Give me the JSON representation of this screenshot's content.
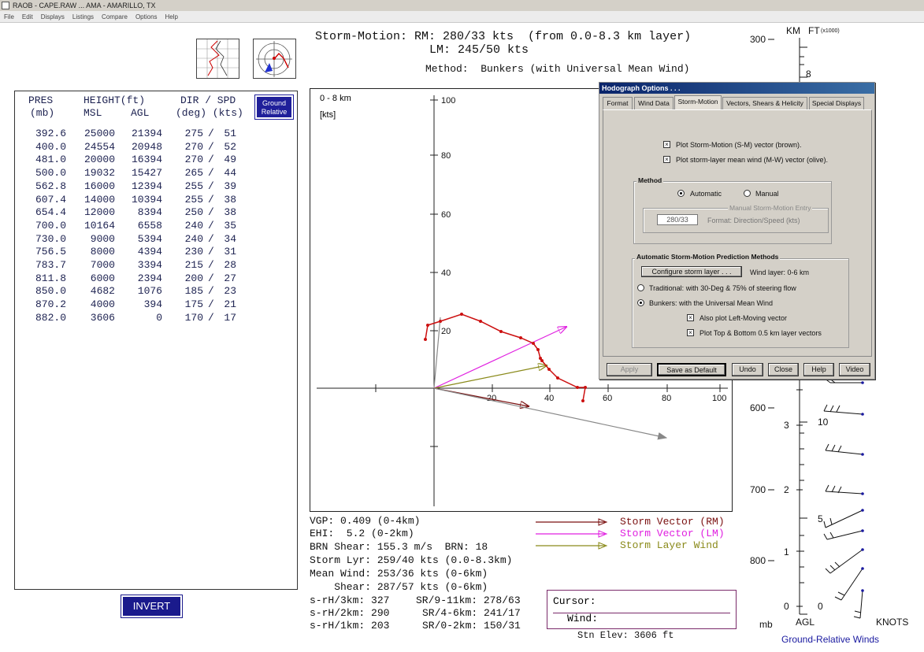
{
  "window": {
    "title": "RAOB  -  CAPE.RAW   ...   AMA - AMARILLO, TX"
  },
  "menu": [
    "File",
    "Edit",
    "Displays",
    "Listings",
    "Compare",
    "Options",
    "Help"
  ],
  "storm_motion": {
    "line1": "Storm-Motion: RM: 280/33 kts  (from 0.0-8.3 km layer)",
    "line2": "LM: 245/50 kts",
    "method": "Method:  Bunkers (with Universal Mean Wind)"
  },
  "table": {
    "headers": {
      "pres": "PRES",
      "pres_unit": "(mb)",
      "height": "HEIGHT(ft)",
      "msl": "MSL",
      "agl": "AGL",
      "dirspd": "DIR / SPD",
      "dirspd_unit": "(deg) (kts)"
    },
    "ground_relative_btn": "Ground Relative",
    "rows": [
      {
        "pres": "392.6",
        "msl": "25000",
        "agl": "21394",
        "dir": "275",
        "spd": "51"
      },
      {
        "pres": "400.0",
        "msl": "24554",
        "agl": "20948",
        "dir": "270",
        "spd": "52"
      },
      {
        "pres": "481.0",
        "msl": "20000",
        "agl": "16394",
        "dir": "270",
        "spd": "49"
      },
      {
        "pres": "500.0",
        "msl": "19032",
        "agl": "15427",
        "dir": "265",
        "spd": "44"
      },
      {
        "pres": "562.8",
        "msl": "16000",
        "agl": "12394",
        "dir": "255",
        "spd": "39"
      },
      {
        "pres": "607.4",
        "msl": "14000",
        "agl": "10394",
        "dir": "255",
        "spd": "38"
      },
      {
        "pres": "654.4",
        "msl": "12000",
        "agl": "8394",
        "dir": "250",
        "spd": "38"
      },
      {
        "pres": "700.0",
        "msl": "10164",
        "agl": "6558",
        "dir": "240",
        "spd": "35"
      },
      {
        "pres": "730.0",
        "msl": "9000",
        "agl": "5394",
        "dir": "240",
        "spd": "34"
      },
      {
        "pres": "756.5",
        "msl": "8000",
        "agl": "4394",
        "dir": "230",
        "spd": "31"
      },
      {
        "pres": "783.7",
        "msl": "7000",
        "agl": "3394",
        "dir": "215",
        "spd": "28"
      },
      {
        "pres": "811.8",
        "msl": "6000",
        "agl": "2394",
        "dir": "200",
        "spd": "27"
      },
      {
        "pres": "850.0",
        "msl": "4682",
        "agl": "1076",
        "dir": "185",
        "spd": "23"
      },
      {
        "pres": "870.2",
        "msl": "4000",
        "agl": "394",
        "dir": "175",
        "spd": "21"
      },
      {
        "pres": "882.0",
        "msl": "3606",
        "agl": "0",
        "dir": "170",
        "spd": "17"
      }
    ],
    "invert_btn": "INVERT"
  },
  "hodograph": {
    "layer_label": "0 - 8 km",
    "units_label": "[kts]",
    "y_ticks": [
      "100",
      "80",
      "60",
      "40",
      "20"
    ],
    "x_ticks": [
      "20",
      "40",
      "60",
      "80",
      "100"
    ]
  },
  "stats": {
    "vgp": "VGP: 0.409 (0-4km)",
    "ehi": "EHI:  5.2 (0-2km)",
    "brn": "BRN Shear: 155.3 m/s  BRN: 18",
    "storm_lyr": "Storm Lyr: 259/40 kts (0.0-8.3km)",
    "mean_wind": "Mean Wind: 253/36 kts (0-6km)",
    "shear": "    Shear: 287/57 kts (0-6km)",
    "srh3": "s-rH/3km: 327",
    "srh2": "s-rH/2km: 290",
    "srh1": "s-rH/1km: 203",
    "sr911": "SR/9-11km: 278/63",
    "sr46": "SR/4-6km: 241/17",
    "sr02": "SR/0-2km: 150/31"
  },
  "legend": [
    {
      "label": "Storm Vector (RM)",
      "color": "#7a1010"
    },
    {
      "label": "Storm Vector (LM)",
      "color": "#e020e0"
    },
    {
      "label": "Storm Layer Wind",
      "color": "#8a8a1a"
    }
  ],
  "cursor": {
    "cursor_label": "Cursor:",
    "wind_label": "Wind:"
  },
  "stn_elev": "Stn Elev: 3606 ft",
  "right_scale": {
    "km_label": "KM",
    "ft_label": "FT",
    "ft_unit": "(x1000)",
    "mb_top": "300",
    "ft_top": "8",
    "mb_labels": [
      "600",
      "700",
      "800"
    ],
    "km_labels": [
      "3",
      "2",
      "1",
      "0"
    ],
    "ft_labels": [
      "10",
      "5",
      "0"
    ],
    "mb_unit": "mb",
    "agl_label": "AGL",
    "knots_label": "KNOTS",
    "footer": "Ground-Relative Winds"
  },
  "dialog": {
    "title": "Hodograph Options . . .",
    "tabs": [
      "Format",
      "Wind Data",
      "Storm-Motion",
      "Vectors, Shears & Helicity",
      "Special Displays"
    ],
    "active_tab": "Storm-Motion",
    "plot_sm": "Plot Storm-Motion (S-M) vector  (brown).",
    "plot_mw": "Plot storm-layer mean wind (M-W) vector  (olive).",
    "method_group": "Method",
    "automatic": "Automatic",
    "manual": "Manual",
    "manual_entry_group": "Manual Storm-Motion Entry",
    "manual_value": "280/33",
    "manual_format": "Format: Direction/Speed  (kts)",
    "auto_group": "Automatic Storm-Motion Prediction Methods",
    "configure_btn": "Configure storm layer  . . .",
    "wind_layer": "Wind layer: 0-6 km",
    "traditional": "Traditional:  with 30-Deg & 75% of steering flow",
    "bunkers": "Bunkers:  with the Universal Mean Wind",
    "also_lm": "Also plot Left-Moving vector",
    "plot_topbottom": "Plot Top & Bottom 0.5 km layer vectors",
    "buttons": [
      "Apply",
      "Save as Default",
      "Undo",
      "Close",
      "Help",
      "Video"
    ]
  }
}
